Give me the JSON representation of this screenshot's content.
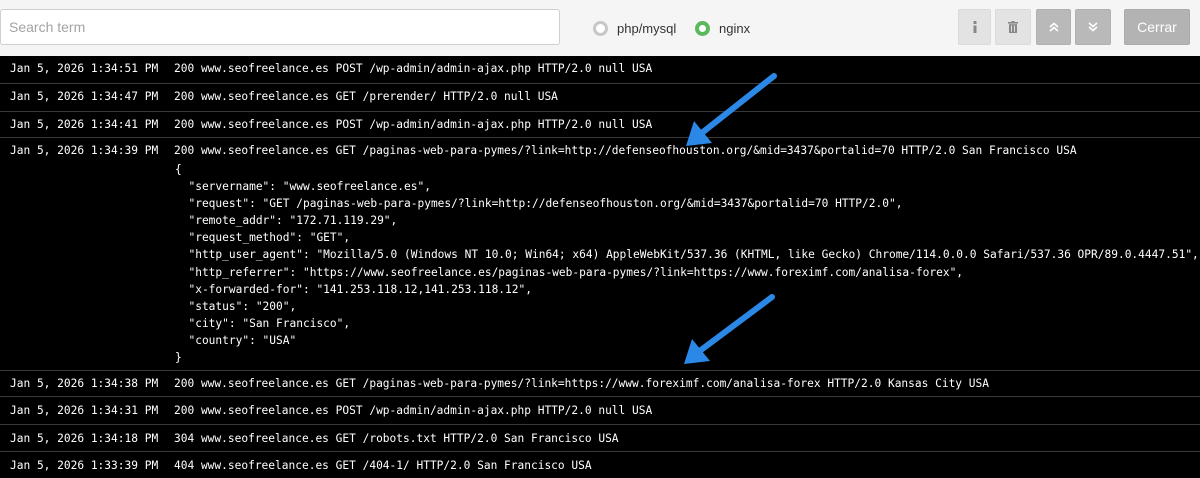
{
  "search": {
    "placeholder": "Search term",
    "value": ""
  },
  "filters": [
    {
      "label": "php/mysql",
      "checked": false
    },
    {
      "label": "nginx",
      "checked": true
    }
  ],
  "buttons": {
    "info_icon": "info-icon",
    "delete_icon": "trash-icon",
    "scroll_up_icon": "double-chevron-up-icon",
    "scroll_down_icon": "double-chevron-down-icon",
    "close_label": "Cerrar"
  },
  "colors": {
    "accent_green": "#5cb85c",
    "arrow_blue": "#2b88e6",
    "log_background": "#000000"
  },
  "log": [
    {
      "date": "Jan 5, 2026 1:34:51 PM",
      "entry": "200 www.seofreelance.es POST /wp-admin/admin-ajax.php HTTP/2.0 null USA"
    },
    {
      "date": "Jan 5, 2026 1:34:47 PM",
      "entry": "200 www.seofreelance.es GET /prerender/ HTTP/2.0 null USA"
    },
    {
      "date": "Jan 5, 2026 1:34:41 PM",
      "entry": "200 www.seofreelance.es POST /wp-admin/admin-ajax.php HTTP/2.0 null USA"
    },
    {
      "date": "Jan 5, 2026 1:34:39 PM",
      "entry": "200 www.seofreelance.es GET /paginas-web-para-pymes/?link=http://defenseofhouston.org/&mid=3437&portalid=70 HTTP/2.0 San Francisco USA",
      "details": "{\n  \"servername\": \"www.seofreelance.es\",\n  \"request\": \"GET /paginas-web-para-pymes/?link=http://defenseofhouston.org/&mid=3437&portalid=70 HTTP/2.0\",\n  \"remote_addr\": \"172.71.119.29\",\n  \"request_method\": \"GET\",\n  \"http_user_agent\": \"Mozilla/5.0 (Windows NT 10.0; Win64; x64) AppleWebKit/537.36 (KHTML, like Gecko) Chrome/114.0.0.0 Safari/537.36 OPR/89.0.4447.51\",\n  \"http_referrer\": \"https://www.seofreelance.es/paginas-web-para-pymes/?link=https://www.foreximf.com/analisa-forex\",\n  \"x-forwarded-for\": \"141.253.118.12,141.253.118.12\",\n  \"status\": \"200\",\n  \"city\": \"San Francisco\",\n  \"country\": \"USA\"\n}"
    },
    {
      "date": "Jan 5, 2026 1:34:38 PM",
      "entry": "200 www.seofreelance.es GET /paginas-web-para-pymes/?link=https://www.foreximf.com/analisa-forex HTTP/2.0 Kansas City USA"
    },
    {
      "date": "Jan 5, 2026 1:34:31 PM",
      "entry": "200 www.seofreelance.es POST /wp-admin/admin-ajax.php HTTP/2.0 null USA"
    },
    {
      "date": "Jan 5, 2026 1:34:18 PM",
      "entry": "304 www.seofreelance.es GET /robots.txt HTTP/2.0 San Francisco USA"
    },
    {
      "date": "Jan 5, 2026 1:33:39 PM",
      "entry": "404 www.seofreelance.es GET /404-1/ HTTP/2.0 San Francisco USA"
    }
  ]
}
